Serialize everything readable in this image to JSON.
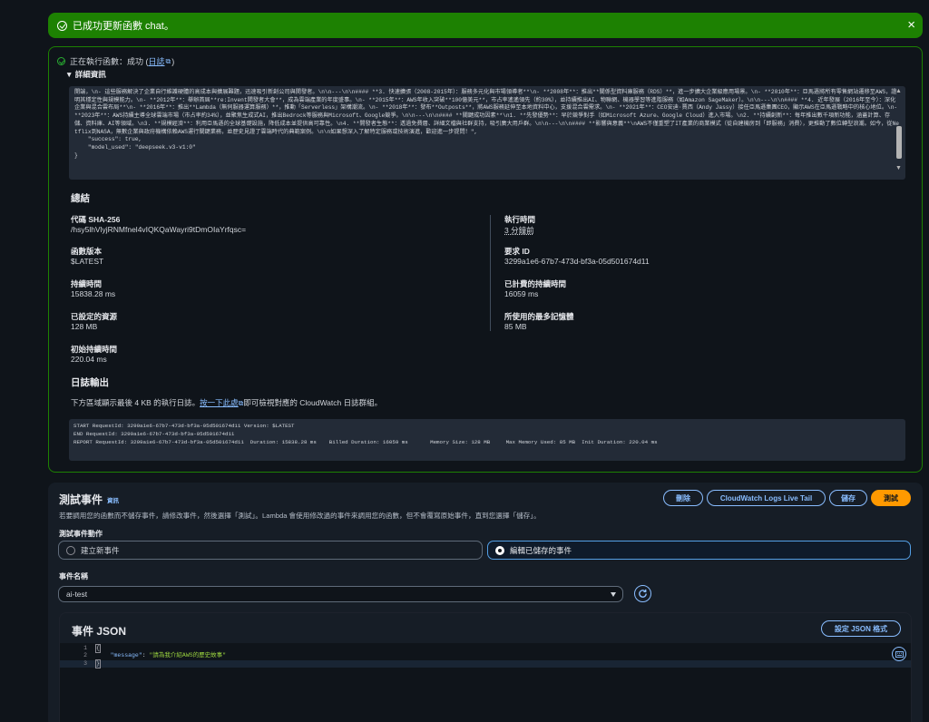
{
  "flash": {
    "message": "已成功更新函數 chat。",
    "close": "×"
  },
  "exec": {
    "status_prefix": "正在執行函數：成功 (",
    "status_link": "日誌",
    "status_suffix": ")",
    "details_toggle": "▼ 詳細資訊",
    "json_output": "開端，\\n- 這些服務解決了企業自行維護硬體的高成本與擴展難題，迅速吸引新創公司與開發者。\\n\\n---\\n\\n#### **3. 快速擴張（2008-2015年）：服務多元化與市場領導者**\\n- **2008年**：推出**關係型資料庫服務（RDS）**，進一步擴大企業級應用場景。\\n- **2010年**：亞馬遜將所有零售網站遷移至AWS，證明其穩定性與規模能力。\\n- **2012年**：舉辦首屆**re:Invent開發者大會**，成為雲端產業的年度盛事。\\n- **2015年**：AWS年收入突破**100億美元**，市占率遙遙領先（約30%），並持續推出AI、物聯網、機器學習等進階服務（如Amazon SageMaker）。\\n\\n---\\n\\n#### **4. 近年發展（2016年至今）：深化企業與混合雲布局**\\n- **2016年**：推出**Lambda（無伺服器運算服務）**，推動「Serverless」架構潮流。\\n- **2018年**：發布**Outposts**，將AWS服務延伸至本地資料中心，支援混合雲需求。\\n- **2021年**：CEO安迪·賈西（Andy Jassy）接任亞馬遜集團CEO，顯示AWS在亞馬遜戰略中的核心地位。\\n- **2023年**：AWS持續主導全球雲端市場（市占率約34%），並聚焦生成式AI，推出Bedrock等服務與Microsoft、Google競爭。\\n\\n---\\n\\n#### **關鍵成功因素**\\n1. **先發優勢**：早於競爭對手（如Microsoft Azure、Google Cloud）進入市場。\\n2. **持續創新**：每年推出數千項新功能，涵蓋計算、存儲、資料庫、AI等領域。\\n3. **規模經濟**：利用亞馬遜的全球基礎設施，降低成本並提供高可靠性。\\n4. **開發者生態**：透過免費層、詳細文檔與社群支持，吸引廣大用戶群。\\n\\n---\\n\\n#### **影響與意義**\\nAWS不僅重塑了IT產業的商業模式（從自建機房到「即服務」消費），更推動了數位轉型浪潮。如今，從Netflix到NASA，無數企業與政府機構依賴AWS運行關鍵業務，並歷史見證了雲端時代的典範案例。\\n\\n如果想深入了解特定服務或技術演進，歡迎進一步提問！\",\n    \"success\": true,\n    \"model_used\": \"deepseek.v3-v1:0\"\n}"
  },
  "summary": {
    "title": "總結",
    "fields": [
      {
        "label": "代碼 SHA-256",
        "value": "/hsy5lhVlyjRNMfnel4vIQKQaWayri9tDmOIaYrfqsc="
      },
      {
        "label": "執行時間",
        "value": "3 分鐘前"
      },
      {
        "label": "函數版本",
        "value": "$LATEST"
      },
      {
        "label": "要求 ID",
        "value": "3299a1e6-67b7-473d-bf3a-05d501674d11"
      },
      {
        "label": "持續時間",
        "value": "15838.28 ms"
      },
      {
        "label": "已計費的持續時間",
        "value": "16059 ms"
      },
      {
        "label": "已設定的資源",
        "value": "128 MB"
      },
      {
        "label": "所使用的最多記憶體",
        "value": "85 MB"
      },
      {
        "label": "初始持續時間",
        "value": "220.04 ms"
      }
    ]
  },
  "logs": {
    "title": "日誌輸出",
    "desc_prefix": "下方區域顯示最後 4 KB 的執行日誌。",
    "desc_link": "按一下此處",
    "desc_suffix": "即可檢視對應的 CloudWatch 日誌群組。",
    "text": "START RequestId: 3299a1e6-67b7-473d-bf3a-05d501674d11 Version: $LATEST\nEND RequestId: 3299a1e6-67b7-473d-bf3a-05d501674d11\nREPORT RequestId: 3299a1e6-67b7-473d-bf3a-05d501674d11  Duration: 15838.28 ms    Billed Duration: 16059 ms       Memory Size: 128 MB     Max Memory Used: 85 MB  Init Duration: 220.04 ms"
  },
  "test": {
    "title": "測試事件",
    "info": "資訊",
    "desc": "若要調用您的函數而不儲存事件，請修改事件，然後選擇「測試」。Lambda 會使用修改過的事件來調用您的函數，但不會覆寫原始事件，直到您選擇「儲存」。",
    "buttons": {
      "delete": "刪除",
      "live_tail": "CloudWatch Logs Live Tail",
      "save": "儲存",
      "test": "測試"
    },
    "action_label": "測試事件動作",
    "option_new": "建立新事件",
    "option_edit": "編輯已儲存的事件",
    "event_name_label": "事件名稱",
    "event_name_value": "ai-test",
    "json_title": "事件 JSON",
    "format_button": "設定 JSON 格式",
    "line_numbers": [
      "1",
      "2",
      "3"
    ],
    "code_open": "{",
    "code_key": "\"message\"",
    "code_colon": ": ",
    "code_value": "\"請為我介紹AWS的歷史故事\"",
    "code_close": "}"
  }
}
